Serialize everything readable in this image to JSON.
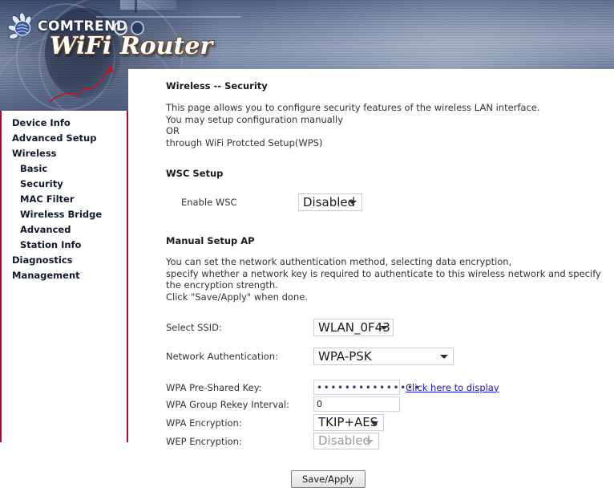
{
  "banner": {
    "brand": "COMTREND",
    "product": "WiFi Router",
    "logo_icon": "comtrend-flower-logo"
  },
  "sidebar": {
    "items": [
      {
        "label": "Device Info",
        "sub": false
      },
      {
        "label": "Advanced Setup",
        "sub": false
      },
      {
        "label": "Wireless",
        "sub": false
      },
      {
        "label": "Basic",
        "sub": true
      },
      {
        "label": "Security",
        "sub": true
      },
      {
        "label": "MAC Filter",
        "sub": true
      },
      {
        "label": "Wireless Bridge",
        "sub": true
      },
      {
        "label": "Advanced",
        "sub": true
      },
      {
        "label": "Station Info",
        "sub": true
      },
      {
        "label": "Diagnostics",
        "sub": false
      },
      {
        "label": "Management",
        "sub": false
      }
    ]
  },
  "page": {
    "title": "Wireless -- Security",
    "intro": "This page allows you to configure security features of the wireless LAN interface.\nYou may setup configuration manually\n        OR\nthrough WiFi Protcted Setup(WPS)",
    "wsc": {
      "heading": "WSC Setup",
      "enable_label": "Enable WSC",
      "enable_value": "Disabled"
    },
    "manual": {
      "heading": "Manual Setup AP",
      "description": "You can set the network authentication method, selecting data encryption,\nspecify whether a network key is required to authenticate to this wireless network and specify the encryption strength.\nClick \"Save/Apply\" when done.",
      "ssid_label": "Select SSID:",
      "ssid_value": "WLAN_0F43",
      "auth_label": "Network Authentication:",
      "auth_value": "WPA-PSK",
      "psk_label": "WPA Pre-Shared Key:",
      "psk_value": "•••••••••••••••",
      "psk_link": "Click here to display",
      "rekey_label": "WPA Group Rekey Interval:",
      "rekey_value": "0",
      "wpa_enc_label": "WPA Encryption:",
      "wpa_enc_value": "TKIP+AES",
      "wep_enc_label": "WEP Encryption:",
      "wep_enc_value": "Disabled"
    },
    "save_button": "Save/Apply"
  },
  "colors": {
    "sidebar_border": "#a30d2d",
    "link": "#1414c8",
    "banner_blue": "#54658c"
  }
}
